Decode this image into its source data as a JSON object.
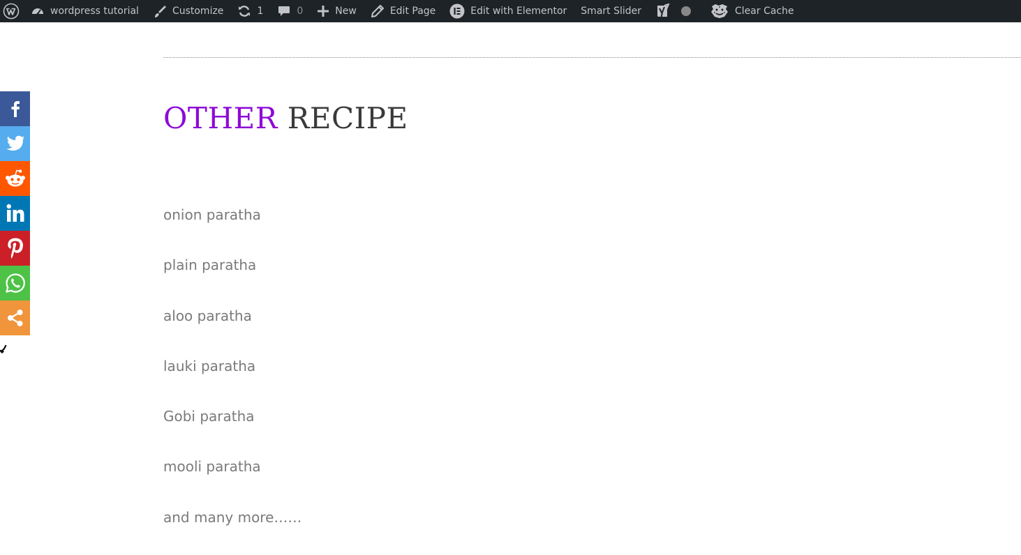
{
  "admin_bar": {
    "site_name": "wordpress tutorial",
    "customize": "Customize",
    "updates_count": "1",
    "comments_count": "0",
    "new": "New",
    "edit_page": "Edit Page",
    "edit_elementor": "Edit with Elementor",
    "smart_slider": "Smart Slider",
    "clear_cache": "Clear Cache"
  },
  "section": {
    "title_accent": "OTHER",
    "title_rest": "RECIPE"
  },
  "recipes": [
    "onion paratha",
    "plain paratha",
    "aloo paratha",
    "lauki paratha",
    "Gobi paratha",
    "mooli paratha",
    "and many more……"
  ],
  "share": {
    "buttons": [
      {
        "name": "facebook",
        "icon": "facebook-icon",
        "color": "#3b5998"
      },
      {
        "name": "twitter",
        "icon": "twitter-icon",
        "color": "#55acee"
      },
      {
        "name": "reddit",
        "icon": "reddit-icon",
        "color": "#ff5700"
      },
      {
        "name": "linkedin",
        "icon": "linkedin-icon",
        "color": "#0077b5"
      },
      {
        "name": "pinterest",
        "icon": "pinterest-icon",
        "color": "#cb2027"
      },
      {
        "name": "whatsapp",
        "icon": "whatsapp-icon",
        "color": "#4dc247"
      },
      {
        "name": "more",
        "icon": "share-icon",
        "color": "#f0953b"
      }
    ]
  },
  "colors": {
    "admin_bar_bg": "#1d2327",
    "title_accent": "#8e0ad6",
    "title": "#3a3a3a",
    "recipe_text": "#7a7a7a"
  }
}
